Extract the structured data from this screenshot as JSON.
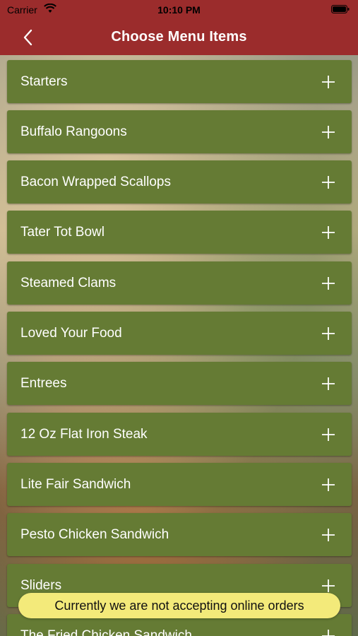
{
  "status_bar": {
    "carrier": "Carrier",
    "time": "10:10 PM"
  },
  "nav": {
    "title": "Choose Menu Items",
    "back_icon": "chevron-left-icon"
  },
  "menu": {
    "items": [
      {
        "label": "Starters"
      },
      {
        "label": "Buffalo Rangoons"
      },
      {
        "label": "Bacon Wrapped Scallops"
      },
      {
        "label": "Tater Tot Bowl"
      },
      {
        "label": "Steamed Clams"
      },
      {
        "label": "Loved Your Food"
      },
      {
        "label": "Entrees"
      },
      {
        "label": "12 Oz Flat Iron Steak"
      },
      {
        "label": "Lite Fair Sandwich"
      },
      {
        "label": "Pesto Chicken Sandwich"
      },
      {
        "label": "Sliders"
      },
      {
        "label": "The Fried Chicken Sandwich"
      }
    ],
    "expand_icon": "plus-icon"
  },
  "toast": {
    "message": "Currently we are not accepting online orders"
  },
  "colors": {
    "nav_background": "#9b2c2c",
    "row_background": "#657b34",
    "toast_background": "#f3ea7a"
  }
}
